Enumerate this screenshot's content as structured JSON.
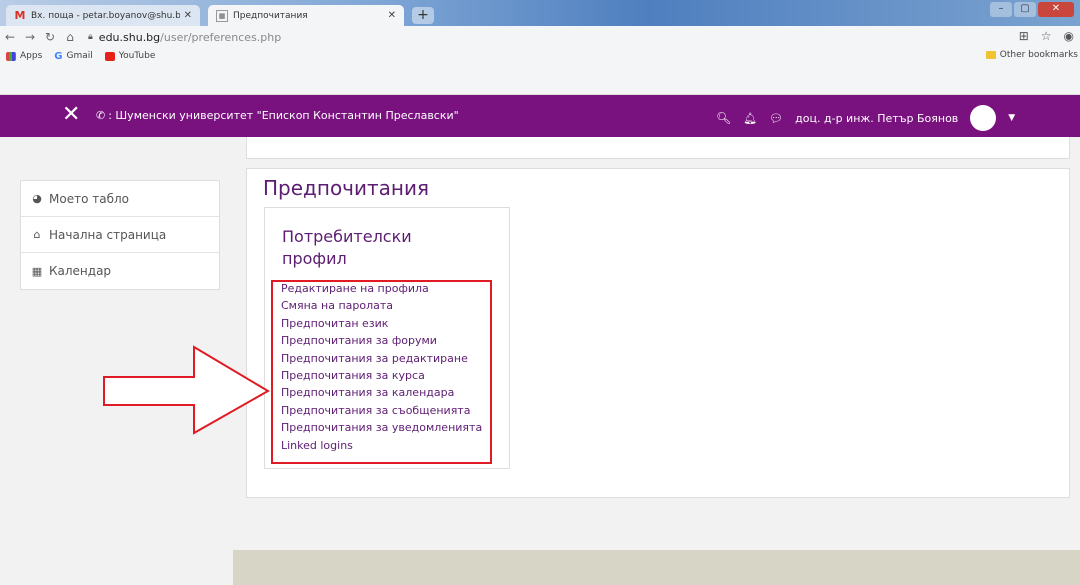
{
  "browser": {
    "tabs": [
      {
        "label": "Вх. поща - petar.boyanov@shu.bg",
        "favicon": "gmail-icon"
      },
      {
        "label": "Предпочитания",
        "favicon": "moodle-icon"
      }
    ],
    "url_host": "edu.shu.bg",
    "url_path": "/user/preferences.php",
    "bookmarks": [
      "Apps",
      "Gmail",
      "YouTube"
    ],
    "other_bookmarks": "Other bookmarks"
  },
  "navbar": {
    "site_name": ": Шуменски университет \"Епископ Константин Преславски\"",
    "user_name": "доц. д-р инж. Петър Боянов",
    "color": "#79127f"
  },
  "drawer": {
    "items": [
      {
        "label": "Моето табло",
        "icon": "dashboard-icon"
      },
      {
        "label": "Начална страница",
        "icon": "home-icon"
      },
      {
        "label": "Календар",
        "icon": "calendar-icon"
      }
    ]
  },
  "main": {
    "title": "Предпочитания",
    "section_title": "Потребителски профил",
    "links": [
      "Редактиране на профила",
      "Смяна на паролата",
      "Предпочитан език",
      "Предпочитания за форуми",
      "Предпочитания за редактиране",
      "Предпочитания за курса",
      "Предпочитания за календара",
      "Предпочитания за съобщенията",
      "Предпочитания за уведомленията",
      "Linked logins"
    ]
  },
  "colors": {
    "accent": "#79127f",
    "link": "#5d1d72",
    "highlight": "#e01b24"
  }
}
